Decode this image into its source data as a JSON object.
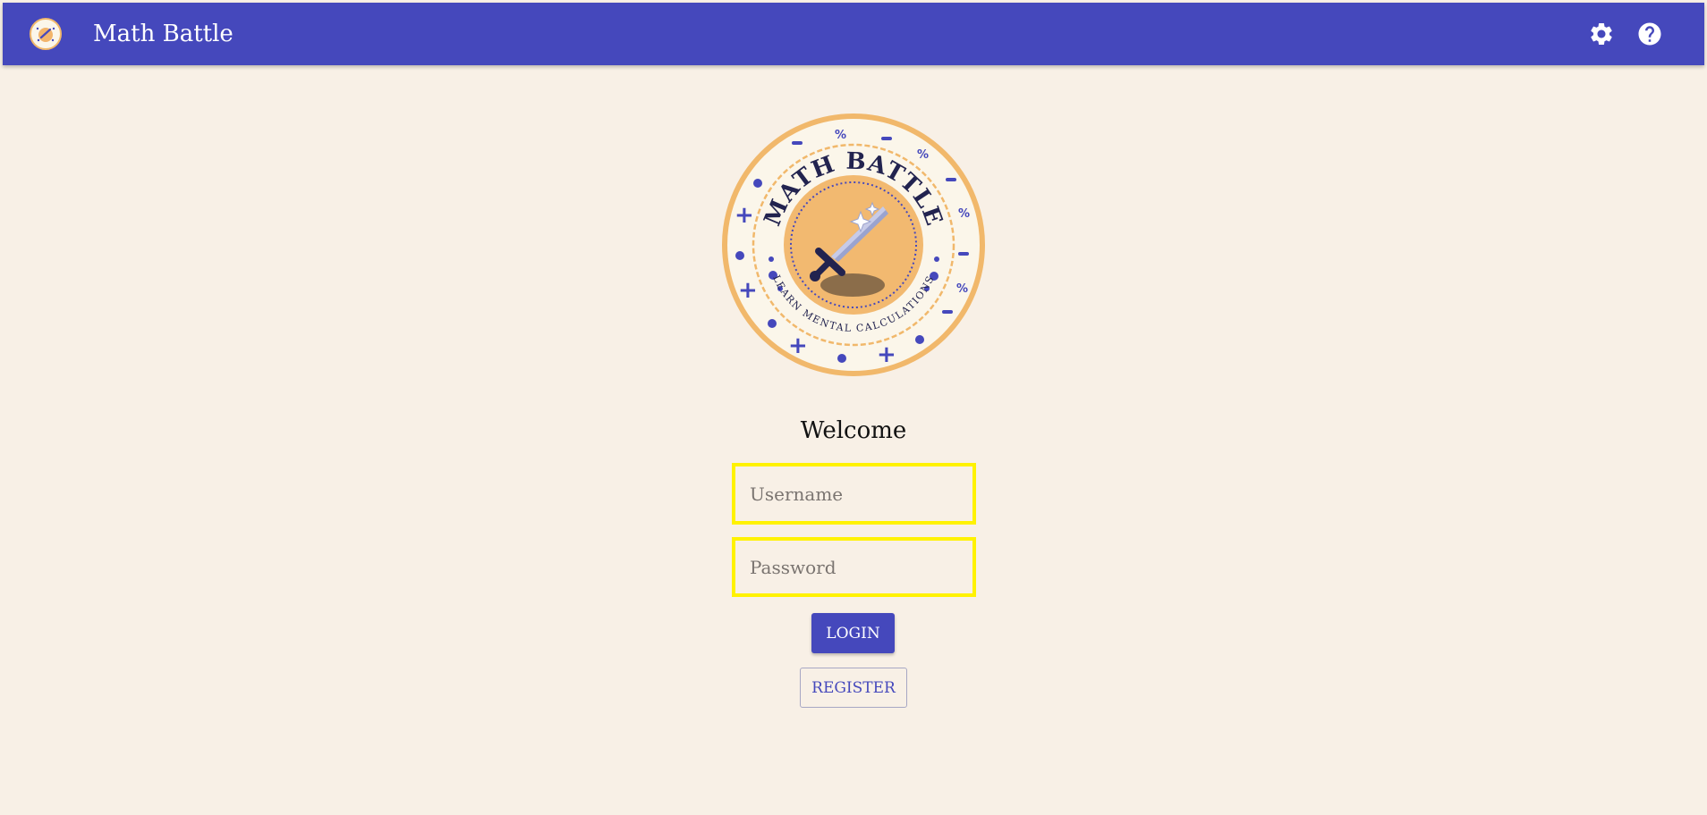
{
  "app": {
    "title": "Math Battle",
    "brand_color": "#4548bc",
    "background_color": "#f8f0e6"
  },
  "header": {
    "logo_icon": "math-battle-logo-icon",
    "settings_icon": "gear-icon",
    "help_icon": "question-mark-icon"
  },
  "emblem": {
    "top_text": "MATH BATTLE",
    "bottom_text": "LEARN MENTAL CALCULATIONS",
    "icon": "sword-icon"
  },
  "login": {
    "welcome": "Welcome",
    "username_placeholder": "Username",
    "username_value": "",
    "password_placeholder": "Password",
    "password_value": "",
    "login_label": "LOGIN",
    "register_label": "REGISTER",
    "highlight_color": "#fff200"
  }
}
